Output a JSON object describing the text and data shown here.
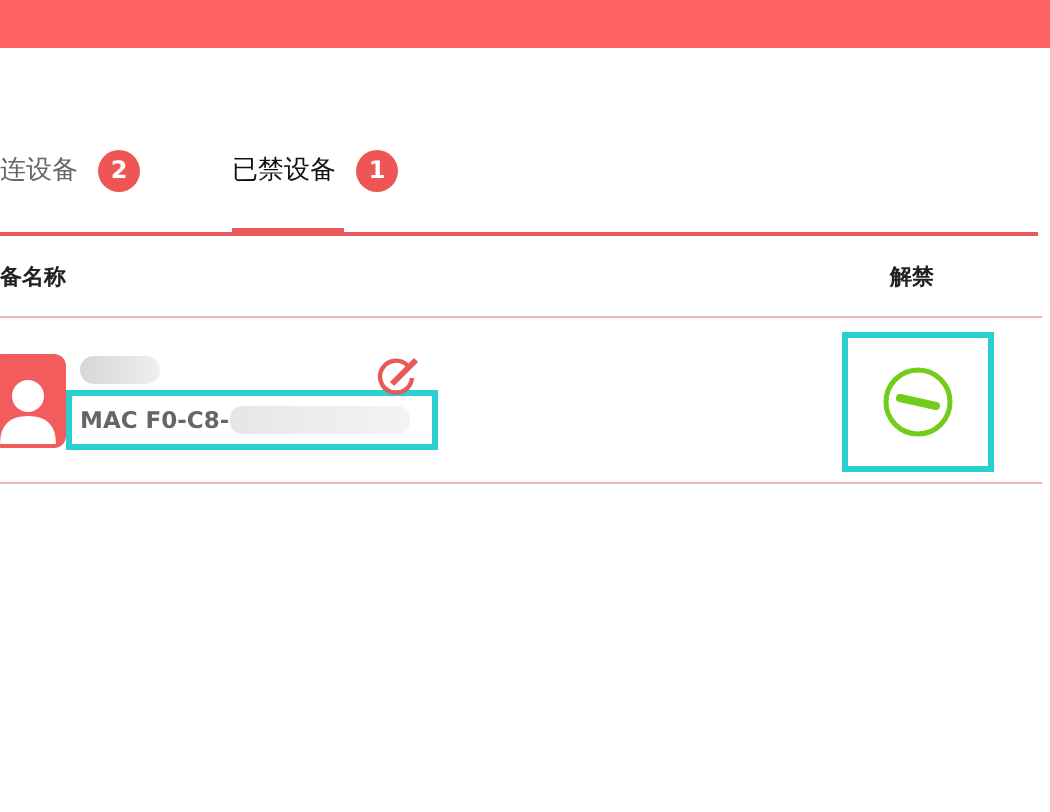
{
  "tabs": [
    {
      "label": "连设备",
      "badge": "2",
      "selected": false
    },
    {
      "label": "已禁设备",
      "badge": "1",
      "selected": true
    }
  ],
  "table": {
    "columns": [
      "备名称",
      "解禁"
    ],
    "rows": [
      {
        "mac": "MAC F0-C8-",
        "highlighted": true,
        "unblock_highlighted": true
      }
    ]
  }
}
